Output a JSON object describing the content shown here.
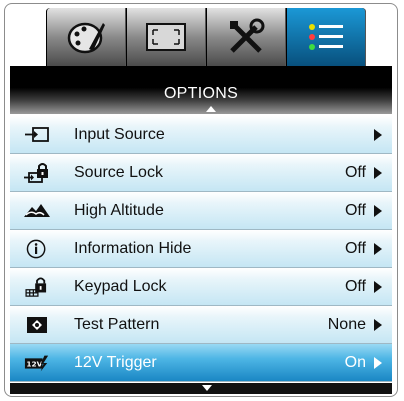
{
  "tabs": [
    {
      "icon": "palette-icon",
      "active": false
    },
    {
      "icon": "screen-resize-icon",
      "active": false
    },
    {
      "icon": "tools-icon",
      "active": false
    },
    {
      "icon": "list-icon",
      "active": true
    }
  ],
  "header": {
    "title": "OPTIONS"
  },
  "menu": {
    "items": [
      {
        "label": "Input Source",
        "value": "",
        "icon": "input-source-icon"
      },
      {
        "label": "Source Lock",
        "value": "Off",
        "icon": "source-lock-icon"
      },
      {
        "label": "High Altitude",
        "value": "Off",
        "icon": "high-altitude-icon"
      },
      {
        "label": "Information Hide",
        "value": "Off",
        "icon": "information-icon"
      },
      {
        "label": "Keypad Lock",
        "value": "Off",
        "icon": "keypad-lock-icon"
      },
      {
        "label": "Test Pattern",
        "value": "None",
        "icon": "test-pattern-icon"
      },
      {
        "label": "12V Trigger",
        "value": "On",
        "icon": "trigger-12v-icon",
        "selected": true
      }
    ]
  },
  "colors": {
    "selected": "#1a87c4",
    "active_tab": "#1b98d6"
  }
}
